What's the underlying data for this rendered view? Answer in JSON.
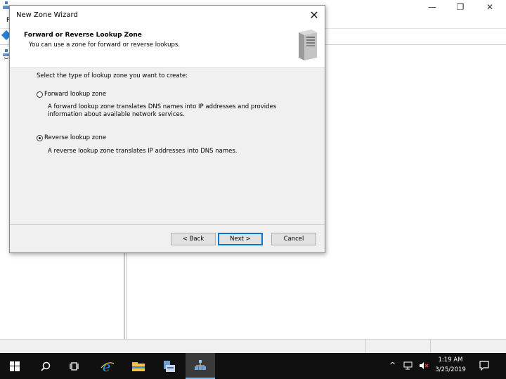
{
  "background_window": {
    "menu_letter": "F",
    "controls": {
      "minimize": "—",
      "restore": "❐",
      "close": "✕"
    }
  },
  "dialog": {
    "title": "New Zone Wizard",
    "close_glyph": "✕",
    "header": {
      "title": "Forward or Reverse Lookup Zone",
      "subtitle": "You can use a zone for forward or reverse lookups."
    },
    "prompt": "Select the type of lookup zone you want to create:",
    "options": [
      {
        "label": "Forward lookup zone",
        "description": "A forward lookup zone translates DNS names into IP addresses and provides information about available network services.",
        "selected": false
      },
      {
        "label": "Reverse lookup zone",
        "description": "A reverse lookup zone translates IP addresses into DNS names.",
        "selected": true
      }
    ],
    "buttons": {
      "back": "< Back",
      "next": "Next >",
      "cancel": "Cancel"
    }
  },
  "taskbar": {
    "items": [
      "start-icon",
      "search-icon",
      "task-view-icon",
      "internet-explorer-icon",
      "file-explorer-icon",
      "server-manager-icon",
      "dns-manager-icon"
    ],
    "tray": {
      "chevron": "^"
    },
    "clock": {
      "time": "1:19 AM",
      "date": "3/25/2019"
    }
  },
  "colors": {
    "accent": "#0078d7",
    "taskbar": "#101010",
    "dialog_bg": "#f0f0f0"
  }
}
